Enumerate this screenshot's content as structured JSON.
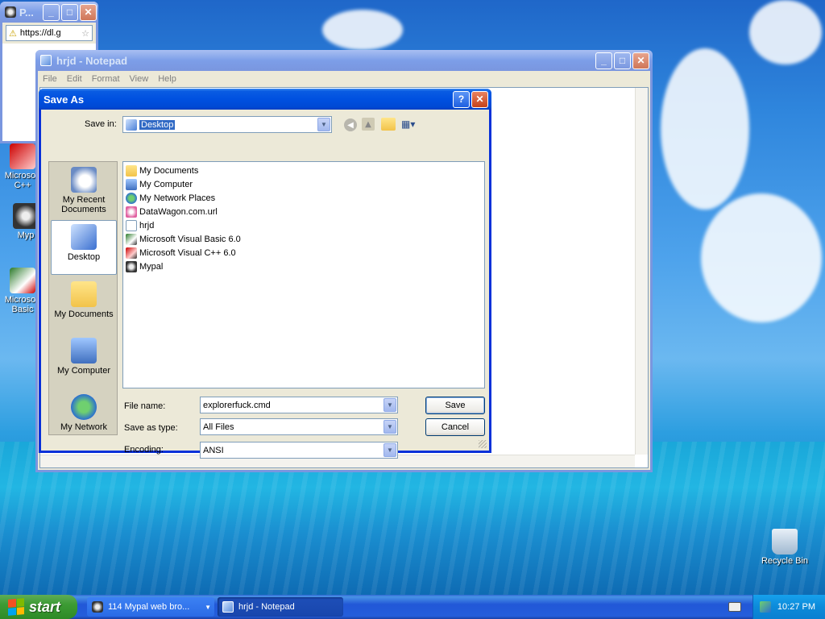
{
  "desktop": {
    "icons": [
      {
        "label": "Microsoft C++"
      },
      {
        "label": "Myp"
      },
      {
        "label": "Microsoft Basic"
      },
      {
        "label": "Recycle Bin"
      }
    ]
  },
  "browser": {
    "title": "P...",
    "url": "https://dl.g"
  },
  "notepad": {
    "title": "hrjd - Notepad",
    "menu": [
      "File",
      "Edit",
      "Format",
      "View",
      "Help"
    ]
  },
  "dialog": {
    "title": "Save As",
    "save_in_label": "Save in:",
    "save_in_value": "Desktop",
    "places": [
      {
        "label": "My Recent Documents"
      },
      {
        "label": "Desktop"
      },
      {
        "label": "My Documents"
      },
      {
        "label": "My Computer"
      },
      {
        "label": "My Network"
      }
    ],
    "files": [
      {
        "name": "My Documents",
        "icon": "folder-icon"
      },
      {
        "name": "My Computer",
        "icon": "computer-icon"
      },
      {
        "name": "My Network Places",
        "icon": "network-icon"
      },
      {
        "name": "DataWagon.com.url",
        "icon": "url-icon"
      },
      {
        "name": "hrjd",
        "icon": "text-file-icon"
      },
      {
        "name": "Microsoft Visual Basic 6.0",
        "icon": "shortcut-icon"
      },
      {
        "name": "Microsoft Visual C++ 6.0",
        "icon": "shortcut-icon"
      },
      {
        "name": "Mypal",
        "icon": "mypal-icon"
      }
    ],
    "file_name_label": "File name:",
    "file_name_value": "explorerfuck.cmd",
    "save_type_label": "Save as type:",
    "save_type_value": "All Files",
    "encoding_label": "Encoding:",
    "encoding_value": "ANSI",
    "save_button": "Save",
    "cancel_button": "Cancel"
  },
  "taskbar": {
    "start_label": "start",
    "tasks": [
      {
        "label": "114 Mypal web bro..."
      },
      {
        "label": "hrjd - Notepad"
      }
    ],
    "clock": "10:27 PM"
  }
}
